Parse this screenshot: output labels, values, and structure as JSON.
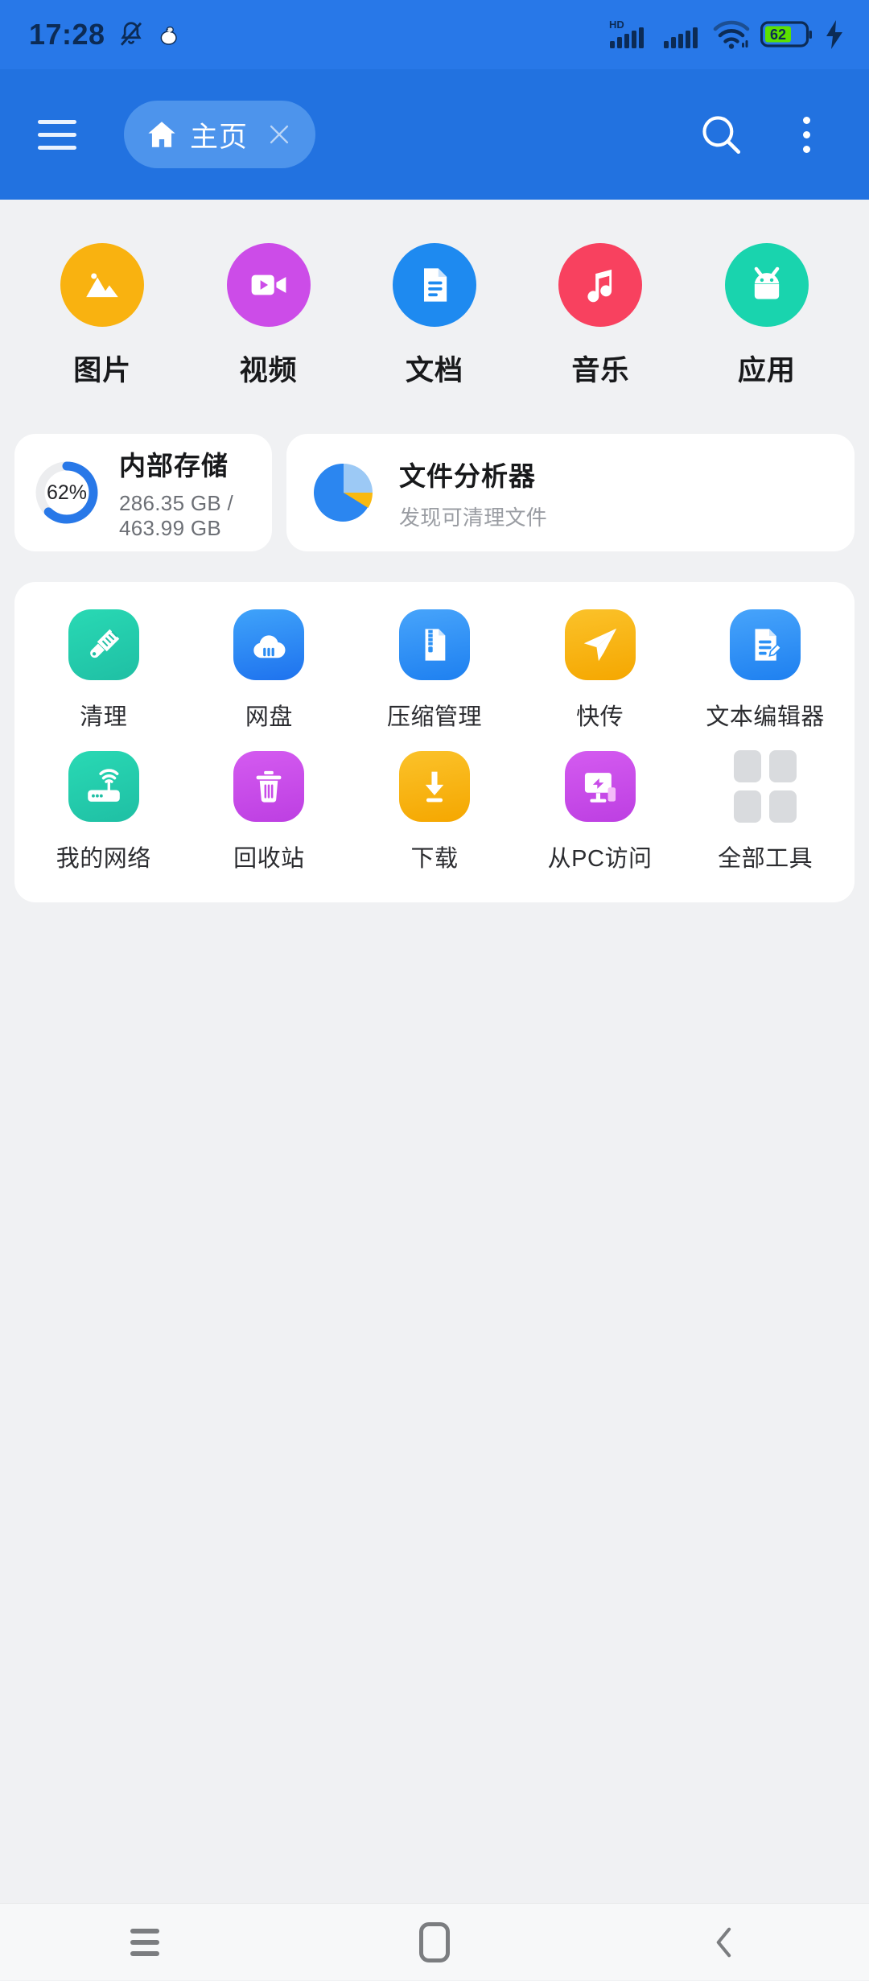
{
  "status_bar": {
    "time": "17:28",
    "icons_left": [
      "bell-mute-icon",
      "app-notification-icon"
    ],
    "icons_right": [
      "hd-signal-icon",
      "signal-icon",
      "wifi-icon",
      "battery-icon",
      "charging-bolt-icon"
    ],
    "network_label": "HD",
    "battery_percent": "62",
    "battery_fill_color": "#5CE000",
    "charging": true
  },
  "toolbar": {
    "menu_icon": "hamburger-icon",
    "tabs": [
      {
        "label": "主页",
        "icon": "home-icon",
        "close_icon": "close-icon",
        "active": true
      }
    ],
    "search_icon": "search-icon",
    "overflow_icon": "overflow-menu-icon",
    "background_color": "#2272E0",
    "tab_active_color": "#4D94EC"
  },
  "categories": [
    {
      "label": "图片",
      "icon": "image-icon",
      "color": "#F9B210"
    },
    {
      "label": "视频",
      "icon": "video-icon",
      "color": "#CC4CE8"
    },
    {
      "label": "文档",
      "icon": "document-icon",
      "color": "#1E8AF0"
    },
    {
      "label": "音乐",
      "icon": "music-icon",
      "color": "#F8415F"
    },
    {
      "label": "应用",
      "icon": "android-icon",
      "color": "#19D4AE"
    }
  ],
  "storage_card": {
    "title": "内部存储",
    "usage": "286.35 GB / 463.99 GB",
    "percent_label": "62%",
    "percent_value": 62,
    "ring_color": "#2878E8",
    "track_color": "#ECEDEF"
  },
  "analyzer_card": {
    "title": "文件分析器",
    "subtitle": "发现可清理文件",
    "icon": "pie-chart-icon",
    "slice_colors": [
      "#2B86F0",
      "#9CC9F5",
      "#F9B910"
    ]
  },
  "tools": [
    [
      {
        "label": "清理",
        "icon": "brush-icon",
        "color": "#20CFAE"
      },
      {
        "label": "网盘",
        "icon": "cloud-icon",
        "color": "#2A8BF2"
      },
      {
        "label": "压缩管理",
        "icon": "zip-file-icon",
        "color": "#2A90F5"
      },
      {
        "label": "快传",
        "icon": "paper-plane-icon",
        "color": "#F9B210"
      },
      {
        "label": "文本编辑器",
        "icon": "text-editor-icon",
        "color": "#2A90F5"
      }
    ],
    [
      {
        "label": "我的网络",
        "icon": "router-icon",
        "color": "#20CFAE"
      },
      {
        "label": "回收站",
        "icon": "trash-icon",
        "color": "#C84CE8"
      },
      {
        "label": "下载",
        "icon": "download-icon",
        "color": "#F9B210"
      },
      {
        "label": "从PC访问",
        "icon": "pc-access-icon",
        "color": "#C84CE8"
      },
      {
        "label": "全部工具",
        "icon": "grid-apps-icon",
        "color": "#D9DBDE"
      }
    ]
  ],
  "navbar": {
    "recents_icon": "recents-icon",
    "home_icon": "home-nav-icon",
    "back_icon": "back-icon"
  },
  "theme": {
    "page_background": "#F0F1F3",
    "card_background": "#FFFFFF",
    "primary": "#2272E0"
  }
}
